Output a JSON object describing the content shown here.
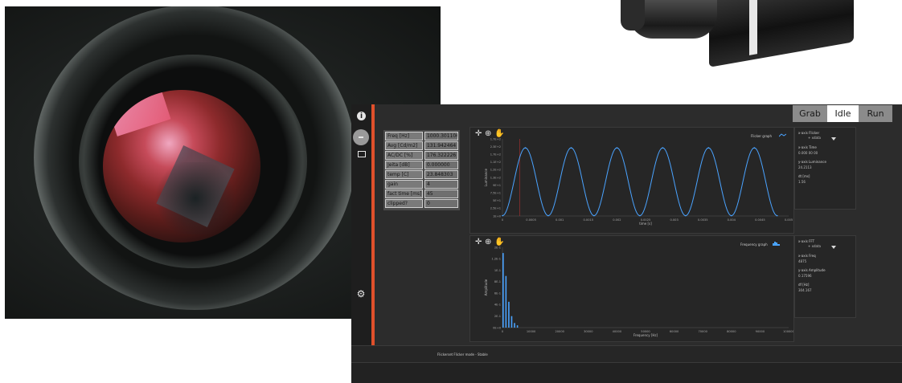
{
  "modes": {
    "grab": "Grab",
    "idle": "Idle",
    "run": "Run",
    "selected": "Idle"
  },
  "table": [
    {
      "key": "Freq [Hz]",
      "value": "1000.301106"
    },
    {
      "key": "Avg [Cd/m2]",
      "value": "131.942464"
    },
    {
      "key": "AC/DC [%]",
      "value": "176.322226"
    },
    {
      "key": "Jeita [dB]",
      "value": "0.000000"
    },
    {
      "key": "temp [C]",
      "value": "23.848303"
    },
    {
      "key": "gain",
      "value": "4"
    },
    {
      "key": "fact time [ms]",
      "value": "45"
    },
    {
      "key": "clipped?",
      "value": "0"
    }
  ],
  "flicker": {
    "label": "Flicker graph",
    "xlabel": "time [s]",
    "ylabel": "Luminance",
    "yticks": [
      "1.7E+2",
      "2.3E+2",
      "1.7E+2",
      "1.1E+2",
      "1.2E+2",
      "1.3E+2",
      "9E+1",
      "7.5E+1",
      "5E+1",
      "2.5E+1",
      "1E+0"
    ],
    "xticks": [
      "0",
      "0.0005",
      "0.001",
      "0.0015",
      "0.002",
      "0.0025",
      "0.003",
      "0.0035",
      "0.004",
      "0.0045",
      "0.005"
    ]
  },
  "frequency": {
    "label": "Frequency graph",
    "xlabel": "Frequency [Hz]",
    "ylabel": "Amplitude",
    "yticks": [
      "2E-1",
      "1.2E-1",
      "1E-1",
      "8E-1",
      "6E-1",
      "4E-1",
      "2E-1",
      "0E+0"
    ],
    "xticks": [
      "0",
      "10000",
      "20000",
      "30000",
      "40000",
      "50000",
      "60000",
      "70000",
      "80000",
      "90000",
      "100000"
    ]
  },
  "side1": {
    "select_label": "x-axis Flicker",
    "select_value": "+ xdata",
    "items": [
      {
        "label": "x-axis Time",
        "value": "0.000 00 00"
      },
      {
        "label": "y-axis Luminance",
        "value": "24.2113"
      },
      {
        "label": "dt [ms]",
        "value": "1.56"
      }
    ]
  },
  "side2": {
    "select_label": "x-axis FFT",
    "select_value": "+ xdata",
    "items": [
      {
        "label": "x-axis Freq",
        "value": "4875"
      },
      {
        "label": "y-axis Amplitude",
        "value": "0.17596"
      },
      {
        "label": "df [Hz]",
        "value": "304.167"
      }
    ]
  },
  "status": {
    "text": "Flickerset Flicker mode - Stable"
  },
  "chart_data": [
    {
      "type": "line",
      "title": "Flicker graph",
      "xlabel": "time [s]",
      "ylabel": "Luminance",
      "xlim": [
        0,
        0.005
      ],
      "ylim": [
        0,
        260
      ],
      "series": [
        {
          "x": [
            0,
            0.0004,
            0.0008,
            0.0012,
            0.0016,
            0.002,
            0.0024,
            0.0028,
            0.0032,
            0.0036,
            0.004,
            0.0044,
            0.0048
          ],
          "values": [
            1,
            230,
            1,
            230,
            1,
            230,
            1,
            230,
            1,
            230,
            1,
            230,
            1
          ]
        }
      ]
    },
    {
      "type": "bar",
      "title": "Frequency graph",
      "xlabel": "Frequency [Hz]",
      "ylabel": "Amplitude",
      "xlim": [
        0,
        100000
      ],
      "ylim": [
        0,
        0.14
      ],
      "categories": [
        "0",
        "1000",
        "2000",
        "3000",
        "4000",
        "5000"
      ],
      "values": [
        0.13,
        0.09,
        0.045,
        0.02,
        0.008,
        0.004
      ]
    }
  ],
  "colors": {
    "accent": "#e0502b",
    "signal": "#4aa3ff",
    "marker": "#b03030"
  }
}
